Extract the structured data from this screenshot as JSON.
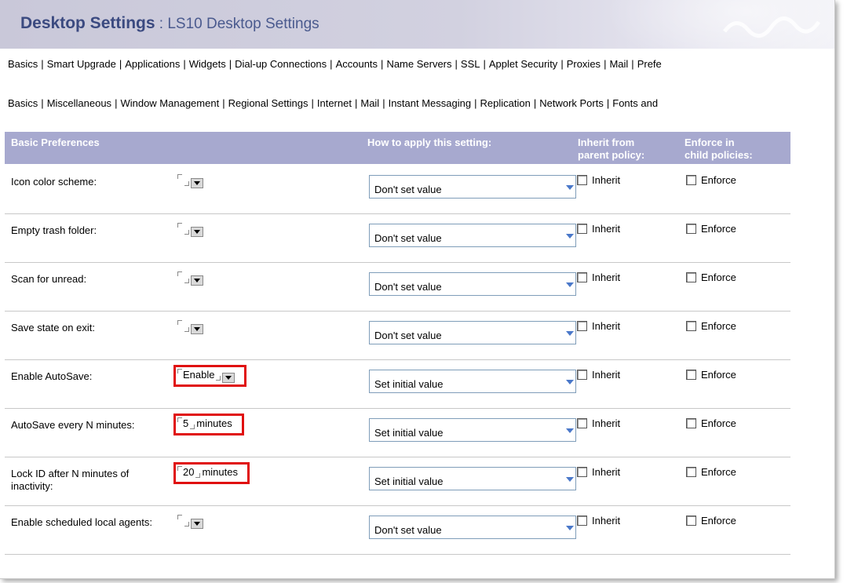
{
  "window": {
    "title_bold": "Desktop Settings",
    "title_rest": " : LS10 Desktop Settings"
  },
  "tabs_primary": [
    "Basics",
    "Smart Upgrade",
    "Applications",
    "Widgets",
    "Dial-up Connections",
    "Accounts",
    "Name Servers",
    "SSL",
    "Applet Security",
    "Proxies",
    "Mail",
    "Prefe"
  ],
  "tabs_secondary": [
    "Basics",
    "Miscellaneous",
    "Window Management",
    "Regional Settings",
    "Internet",
    "Mail",
    "Instant Messaging",
    "Replication",
    "Network Ports",
    "Fonts and"
  ],
  "table": {
    "col_prefs": "Basic Preferences",
    "col_apply": "How to apply this setting:",
    "col_inherit_1": "Inherit from",
    "col_inherit_2": "parent policy:",
    "col_enforce_1": "Enforce in",
    "col_enforce_2": "child policies:",
    "inherit_label": "Inherit",
    "enforce_label": "Enforce",
    "rows": [
      {
        "label": "Icon color scheme:",
        "value": "",
        "suffix": "",
        "apply": "Don't set value",
        "kind": "dropdown",
        "highlight": false
      },
      {
        "label": "Empty trash folder:",
        "value": "",
        "suffix": "",
        "apply": "Don't set value",
        "kind": "dropdown",
        "highlight": false
      },
      {
        "label": "Scan for unread:",
        "value": "",
        "suffix": "",
        "apply": "Don't set value",
        "kind": "dropdown",
        "highlight": false
      },
      {
        "label": "Save state on exit:",
        "value": "",
        "suffix": "",
        "apply": "Don't set value",
        "kind": "dropdown",
        "highlight": false
      },
      {
        "label": "Enable AutoSave:",
        "value": "Enable",
        "suffix": "",
        "apply": "Set initial value",
        "kind": "dropdown",
        "highlight": true
      },
      {
        "label": "AutoSave every N minutes:",
        "value": "5",
        "suffix": "minutes",
        "apply": "Set initial value",
        "kind": "text",
        "highlight": true
      },
      {
        "label": "Lock ID after N minutes of inactivity:",
        "value": "20",
        "suffix": "minutes",
        "apply": "Set initial value",
        "kind": "text",
        "highlight": true
      },
      {
        "label": "Enable scheduled local agents:",
        "value": "",
        "suffix": "",
        "apply": "Don't set value",
        "kind": "dropdown",
        "highlight": false
      }
    ]
  },
  "colors": {
    "header_bg": "#a7a9cf",
    "title_color": "#3b4a80",
    "highlight": "#e01010"
  }
}
